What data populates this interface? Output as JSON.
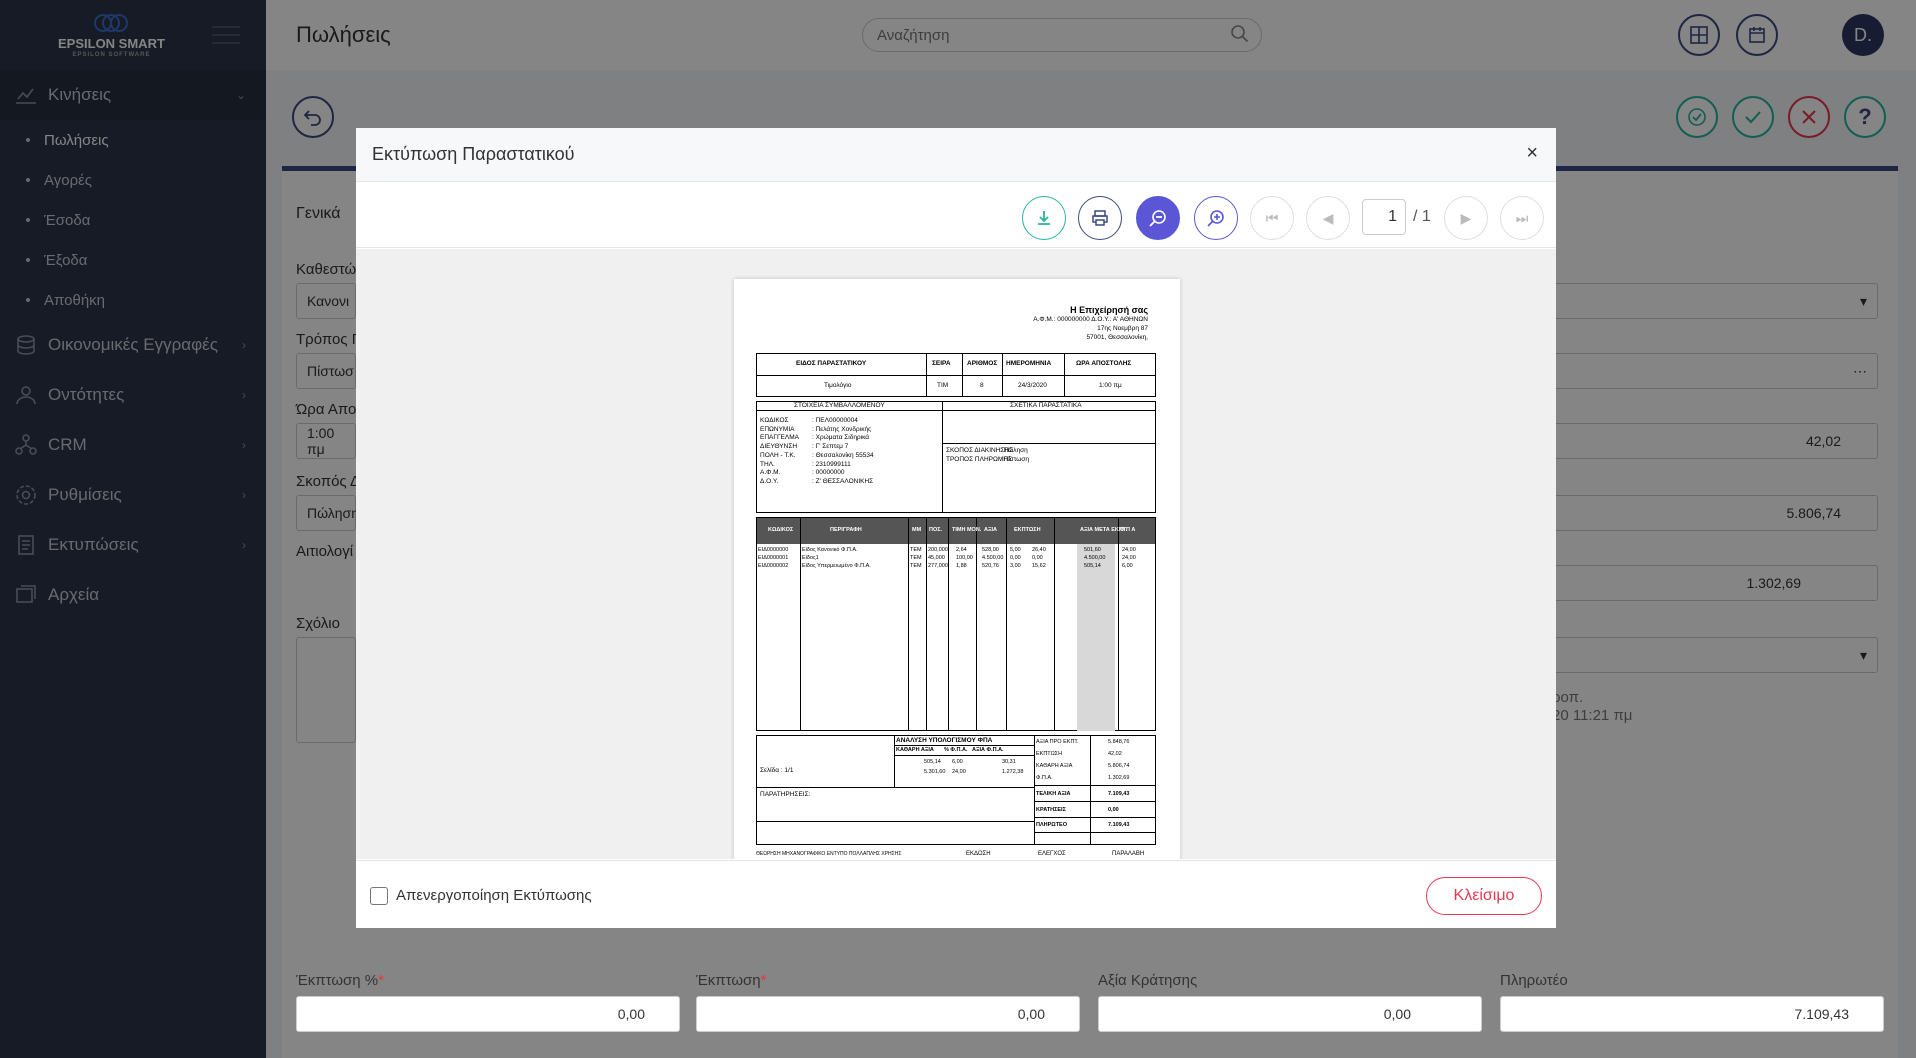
{
  "app": {
    "logo": "EPSILON SMART",
    "logo_sub": "EPSILON SOFTWARE"
  },
  "sidebar": {
    "items": [
      {
        "label": "Κινήσεις",
        "icon": "chart-line-icon",
        "open": true
      },
      {
        "label": "Οικονομικές Εγγραφές",
        "icon": "coins-icon"
      },
      {
        "label": "Οντότητες",
        "icon": "users-icon"
      },
      {
        "label": "CRM",
        "icon": "network-icon"
      },
      {
        "label": "Ρυθμίσεις",
        "icon": "gear-icon"
      },
      {
        "label": "Εκτυπώσεις",
        "icon": "document-icon"
      },
      {
        "label": "Αρχεία",
        "icon": "images-icon"
      }
    ],
    "sub_items": [
      "Πωλήσεις",
      "Αγορές",
      "Έσοδα",
      "Έξοδα",
      "Αποθήκη"
    ]
  },
  "header": {
    "title": "Πωλήσεις",
    "search_placeholder": "Αναζήτηση",
    "avatar": "D."
  },
  "form": {
    "section": "Γενικά",
    "labels": {
      "status": "Καθεστώ",
      "payment": "Τρόπος Π",
      "time": "Ώρα Απο",
      "purpose": "Σκοπός Δ",
      "reason": "Αιτιολογί",
      "comment": "Σχόλιο"
    },
    "values": {
      "status": "Κανονι",
      "payment": "Πίστωσ",
      "time": "1:00 πμ",
      "purpose": "Πώληση"
    },
    "right_values": [
      "42,02",
      "5.806,74",
      "1.302,69"
    ],
    "notes": [
      "ροπ.",
      "20 11:21 πμ"
    ],
    "bottom": {
      "disc_pct_label": "Έκπτωση %",
      "disc_pct": "0,00",
      "disc_label": "Έκπτωση",
      "disc": "0,00",
      "hold_label": "Αξία Κράτησης",
      "hold": "0,00",
      "pay_label": "Πληρωτέο",
      "pay": "7.109,43"
    }
  },
  "modal": {
    "title": "Εκτύπωση Παραστατικού",
    "page": "1",
    "page_total": "/ 1",
    "disable_label": "Απενεργοποίηση Εκτύπωσης",
    "close_label": "Κλείσιμο"
  },
  "doc": {
    "company": "Η Επιχείρησή σας",
    "afm": "Α.Φ.Μ.: 000000000 Δ.Ο.Υ.: Α' ΑΘΗΝΩΝ",
    "addr": "17ης Νοεμβρη 87",
    "city": "57001, Θεσσαλονίκη,",
    "hdr": [
      "ΕΙΔΟΣ ΠΑΡΑΣΤΑΤΙΚΟΥ",
      "ΣΕΙΡΑ",
      "ΑΡΙΘΜΟΣ",
      "ΗΜΕΡΟΜΗΝΙΑ",
      "ΩΡΑ ΑΠΟΣΤΟΛΗΣ"
    ],
    "hdr_vals": [
      "Τιμολόγιο",
      "ΤΙΜ",
      "8",
      "24/3/2020",
      "1:00 πμ"
    ],
    "cust_title": "ΣΤΟΙΧΕΙΑ ΣΥΜΒΑΛΛΟΜΕΝΟΥ",
    "rel_title": "ΣΧΕΤΙΚΑ ΠΑΡΑΣΤΑΤΙΚΑ",
    "cust": [
      [
        "ΚΩΔΙΚΟΣ",
        "ΠΕΛ00000004"
      ],
      [
        "ΕΠΩΝΥΜΙΑ",
        "Πελάτης Χονδρικής"
      ],
      [
        "ΕΠΑΓΓΕΛΜΑ",
        "Χρώματα Σιδηρικά"
      ],
      [
        "ΔΙΕΥΘΥΝΣΗ",
        "Γ' Σεπτεμ 7"
      ],
      [
        "ΠΟΛΗ - Τ.Κ.",
        "Θεσσαλονίκη 55534"
      ],
      [
        "ΤΗΛ.",
        "2310999111"
      ],
      [
        "Α.Φ.Μ.",
        "00000000"
      ],
      [
        "Δ.Ο.Υ.",
        "Ζ' ΘΕΣΣΑΛΟΝΙΚΗΣ"
      ]
    ],
    "move": [
      [
        "ΣΚΟΠΟΣ ΔΙΑΚΙΝΗΣΗΣ",
        "Πώληση"
      ],
      [
        "ΤΡΟΠΟΣ ΠΛΗΡΩΜΗΣ",
        "Πίστωση"
      ]
    ],
    "cols": [
      "ΚΩΔΙΚΟΣ",
      "ΠΕΡΙΓΡΑΦΗ",
      "ΜΜ",
      "ΠΟΣ.",
      "ΤΙΜΗ ΜΟΝ.",
      "ΑΞΙΑ",
      "ΕΚΠΤΩΣΗ",
      "ΑΞΙΑ ΜΕΤΑ ΕΚΠΤ.",
      "Φ Π Α"
    ],
    "rows": [
      [
        "ΕΙΔ0000000",
        "Είδος Κανονικό Φ.Π.Α.",
        "ΤΕΜ",
        "200,000",
        "2,64",
        "528,00",
        "5,00",
        "26,40",
        "501,60",
        "24,00"
      ],
      [
        "ΕΙΔ0000001",
        "Είδος1",
        "ΤΕΜ",
        "45,000",
        "100,00",
        "4.500,00",
        "0,00",
        "0,00",
        "4.500,00",
        "24,00"
      ],
      [
        "ΕΙΔ0000002",
        "Είδος Υπερμειωμένο Φ.Π.Α.",
        "ΤΕΜ",
        "277,000",
        "1,88",
        "520,76",
        "3,00",
        "15,62",
        "505,14",
        "6,00"
      ]
    ],
    "vat_title": "ΑΝΑΛΥΣΗ ΥΠΟΛΟΓΙΣΜΟΥ ΦΠΑ",
    "vat_cols": [
      "ΚΑΘΑΡΗ ΑΞΙΑ",
      "% Φ.Π.Α.",
      "ΑΞΙΑ Φ.Π.Α."
    ],
    "vat_rows": [
      [
        "505,14",
        "6,00",
        "30,31"
      ],
      [
        "5.301,60",
        "24,00",
        "1.272,38"
      ]
    ],
    "page_lbl": "Σελίδα : 1/1",
    "notes_lbl": "ΠΑΡΑΤΗΡΗΣΕΙΣ:",
    "totals": [
      [
        "ΑΞΙΑ ΠΡΟ ΕΚΠΤ.",
        "5.848,76"
      ],
      [
        "ΕΚΠΤΩΣΗ",
        "42,02"
      ],
      [
        "ΚΑΘΑΡΗ ΑΞΙΑ",
        "5.806,74"
      ],
      [
        "Φ.Π.Α.",
        "1.302,69"
      ],
      [
        "ΤΕΛΙΚΗ ΑΞΙΑ",
        "7.109,43"
      ],
      [
        "ΚΡΑΤΗΣΕΙΣ",
        "0,00"
      ],
      [
        "ΠΛΗΡΩΤΕΟ",
        "7.109,43"
      ]
    ],
    "foot": [
      "ΘΕΩΡΗΣΗ ΜΗΧΑΝΟΓΡΑΦΙΚΟ ΕΝΤΥΠΟ ΠΟΛΛΑΠΛΗΣ ΧΡΗΣΗΣ",
      "ΕΚΔΟΣΗ",
      "ΕΛΕΓΧΟΣ",
      "ΠΑΡΑΛΑΒΗ"
    ]
  },
  "colors": {
    "sidebar": "#2c3447",
    "accent": "#3b4a80",
    "teal": "#26b5a0",
    "red": "#e53950",
    "blue": "#5a56d6"
  }
}
